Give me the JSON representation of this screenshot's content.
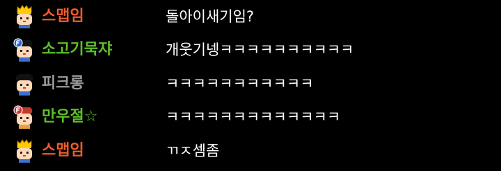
{
  "chat": {
    "messages": [
      {
        "nickname": "스맵임",
        "nickname_color": "#f05a28",
        "avatar_icon": "crown-character-icon",
        "text": "돌아이새기임?"
      },
      {
        "nickname": "소고기묵쟈",
        "nickname_color": "#5cc028",
        "avatar_icon": "fan-badge-character-icon",
        "text": "개웃기넹ㅋㅋㅋㅋㅋㅋㅋㅋㅋㅋ"
      },
      {
        "nickname": "피크롱",
        "nickname_color": "#9a9a9a",
        "avatar_icon": "character-icon",
        "text": "ㅋㅋㅋㅋㅋㅋㅋㅋㅋㅋㅋ"
      },
      {
        "nickname": "만우절☆",
        "nickname_color": "#5cc028",
        "avatar_icon": "fan-badge-character-icon",
        "text": "ㅋㅋㅋㅋㅋㅋㅋㅋㅋㅋㅋㅋㅋ"
      },
      {
        "nickname": "스맵임",
        "nickname_color": "#f05a28",
        "avatar_icon": "crown-character-icon",
        "text": "ㄲㅈ셈좀"
      }
    ]
  }
}
